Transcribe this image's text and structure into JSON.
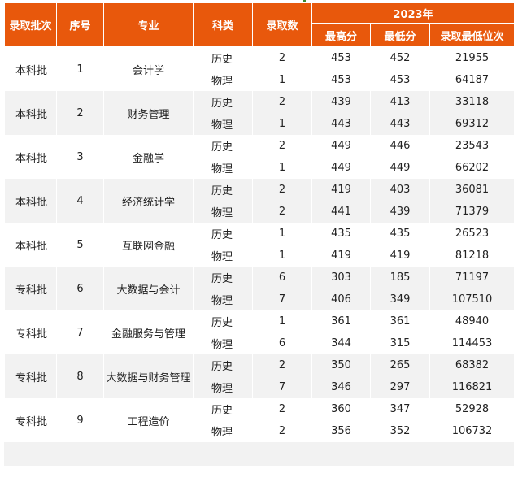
{
  "header": {
    "batch": "录取批次",
    "index": "序号",
    "major": "专业",
    "subject": "科类",
    "count": "录取数",
    "year_group": "2023年",
    "max_score": "最高分",
    "min_score": "最低分",
    "min_rank": "录取最低位次"
  },
  "rows": [
    {
      "batch": "本科批",
      "index": "1",
      "major": "会计学",
      "subjects": [
        {
          "subject": "历史",
          "count": "2",
          "max": "453",
          "min": "452",
          "rank": "21955"
        },
        {
          "subject": "物理",
          "count": "1",
          "max": "453",
          "min": "453",
          "rank": "64187"
        }
      ]
    },
    {
      "batch": "本科批",
      "index": "2",
      "major": "财务管理",
      "subjects": [
        {
          "subject": "历史",
          "count": "2",
          "max": "439",
          "min": "413",
          "rank": "33118"
        },
        {
          "subject": "物理",
          "count": "1",
          "max": "443",
          "min": "443",
          "rank": "69312"
        }
      ]
    },
    {
      "batch": "本科批",
      "index": "3",
      "major": "金融学",
      "subjects": [
        {
          "subject": "历史",
          "count": "2",
          "max": "449",
          "min": "446",
          "rank": "23543"
        },
        {
          "subject": "物理",
          "count": "1",
          "max": "449",
          "min": "449",
          "rank": "66202"
        }
      ]
    },
    {
      "batch": "本科批",
      "index": "4",
      "major": "经济统计学",
      "subjects": [
        {
          "subject": "历史",
          "count": "2",
          "max": "419",
          "min": "403",
          "rank": "36081"
        },
        {
          "subject": "物理",
          "count": "2",
          "max": "441",
          "min": "439",
          "rank": "71379"
        }
      ]
    },
    {
      "batch": "本科批",
      "index": "5",
      "major": "互联网金融",
      "subjects": [
        {
          "subject": "历史",
          "count": "1",
          "max": "435",
          "min": "435",
          "rank": "26523"
        },
        {
          "subject": "物理",
          "count": "1",
          "max": "419",
          "min": "419",
          "rank": "81218"
        }
      ]
    },
    {
      "batch": "专科批",
      "index": "6",
      "major": "大数据与会计",
      "subjects": [
        {
          "subject": "历史",
          "count": "6",
          "max": "303",
          "min": "185",
          "rank": "71197"
        },
        {
          "subject": "物理",
          "count": "7",
          "max": "406",
          "min": "349",
          "rank": "107510"
        }
      ]
    },
    {
      "batch": "专科批",
      "index": "7",
      "major": "金融服务与管理",
      "subjects": [
        {
          "subject": "历史",
          "count": "1",
          "max": "361",
          "min": "361",
          "rank": "48940"
        },
        {
          "subject": "物理",
          "count": "6",
          "max": "344",
          "min": "315",
          "rank": "114453"
        }
      ]
    },
    {
      "batch": "专科批",
      "index": "8",
      "major": "大数据与财务管理",
      "subjects": [
        {
          "subject": "历史",
          "count": "2",
          "max": "350",
          "min": "265",
          "rank": "68382"
        },
        {
          "subject": "物理",
          "count": "7",
          "max": "346",
          "min": "297",
          "rank": "116821"
        }
      ]
    },
    {
      "batch": "专科批",
      "index": "9",
      "major": "工程造价",
      "subjects": [
        {
          "subject": "历史",
          "count": "2",
          "max": "360",
          "min": "347",
          "rank": "52928"
        },
        {
          "subject": "物理",
          "count": "2",
          "max": "356",
          "min": "352",
          "rank": "106732"
        }
      ]
    }
  ]
}
